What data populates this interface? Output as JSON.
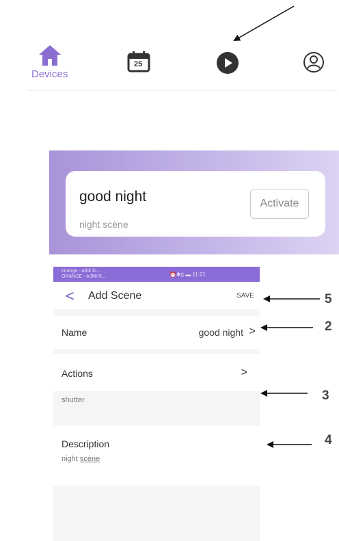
{
  "top_nav": {
    "items": [
      {
        "icon": "home-icon",
        "label": "Devices",
        "active_color": "#8a6fd0"
      },
      {
        "icon": "calendar-icon",
        "badge": "25"
      },
      {
        "icon": "play-icon"
      },
      {
        "icon": "user-icon"
      }
    ]
  },
  "scene_card": {
    "title": "good night",
    "subtitle": "night scène",
    "activate_label": "Activate"
  },
  "phone": {
    "status_bar": {
      "carrier_line1": "Orange - Afrik fo...",
      "carrier_line2": "ORANGE - AJMI R...",
      "right": "⏰✱▯ ▬ 11:21",
      "color": "#8b6cd6"
    },
    "app_bar": {
      "back": "<",
      "title": "Add Scene",
      "save_label": "SAVE"
    },
    "name_row": {
      "label": "Name",
      "value": "good night",
      "chevron": ">"
    },
    "actions_row": {
      "label": "Actions",
      "chevron": ">",
      "sub": "shutter"
    },
    "description_row": {
      "label": "Description",
      "value_plain": "night ",
      "value_underlined": "scène"
    }
  },
  "annotations": {
    "save_number": "5",
    "name_number": "2",
    "actions_number": "3",
    "description_number": "4"
  }
}
